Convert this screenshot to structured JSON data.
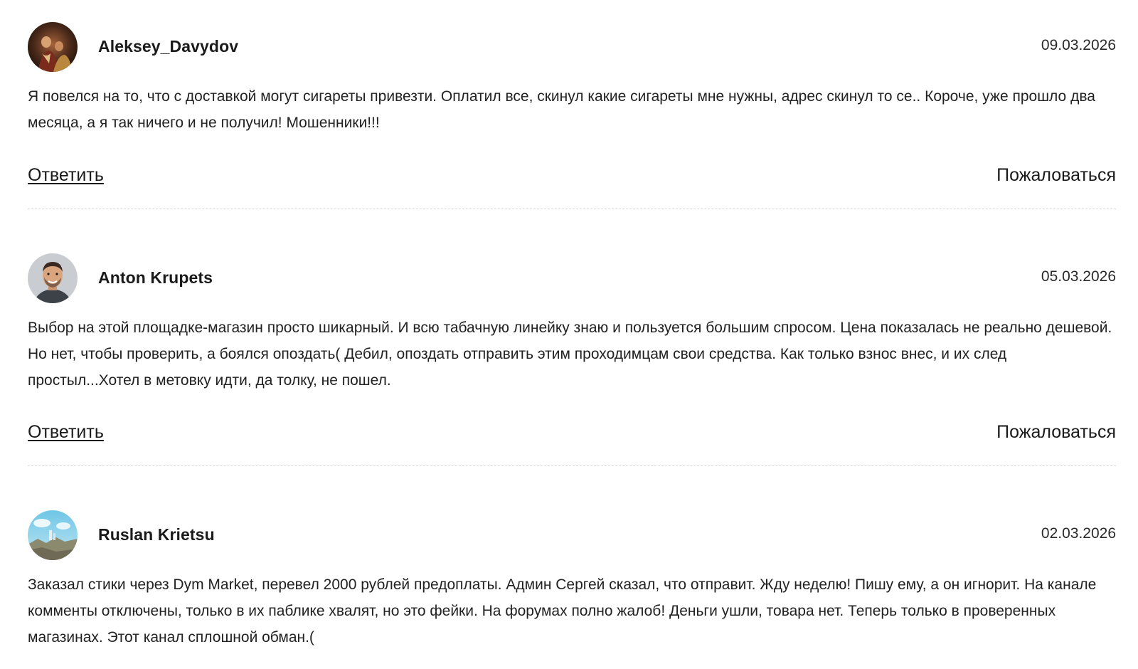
{
  "comments": [
    {
      "author": "Aleksey_Davydov",
      "date": "09.03.2026",
      "text": "Я повелся на то, что с доставкой могут сигареты привезти. Оплатил все, скинул какие сигареты мне нужны, адрес скинул то се.. Короче, уже прошло два месяца, а я так ничего и не получил! Мошенники!!!",
      "reply_label": "Ответить",
      "report_label": "Пожаловаться"
    },
    {
      "author": "Anton Krupets",
      "date": "05.03.2026",
      "text": "Выбор на этой площадке-магазин просто шикарный. И всю табачную линейку знаю и пользуется большим спросом. Цена показалась не реально дешевой. Но нет, чтобы проверить, а боялся опоздать( Дебил, опоздать отправить этим проходимцам свои средства. Как только взнос внес, и их след простыл...Хотел в метовку идти, да толку, не пошел.",
      "reply_label": "Ответить",
      "report_label": "Пожаловаться"
    },
    {
      "author": "Ruslan Krietsu",
      "date": "02.03.2026",
      "text": "Заказал стики через Dym Market, перевел 2000 рублей предоплаты. Админ Сергей сказал, что отправит. Жду неделю! Пишу ему, а он игнорит. На канале комменты отключены, только в их паблике хвалят, но это фейки. На форумах полно жалоб! Деньги ушли, товара нет. Теперь только в проверенных магазинах. Этот канал сплошной обман.("
    }
  ]
}
